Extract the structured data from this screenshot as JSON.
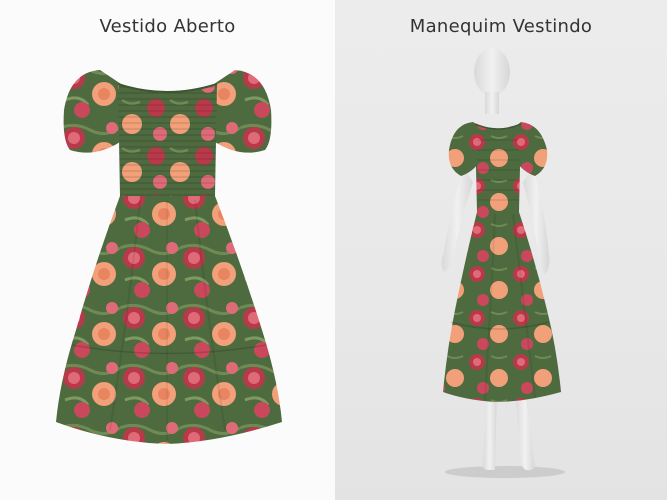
{
  "panels": {
    "left": {
      "title": "Vestido Aberto"
    },
    "right": {
      "title": "Manequim Vestindo"
    }
  },
  "colors": {
    "dress_green": "#4e6a3f",
    "flower_red": "#b8394a",
    "flower_pink": "#e06b78",
    "flower_peach": "#f2a07a",
    "flower_orange": "#e88560",
    "mannequin": "#e9e9e9"
  }
}
